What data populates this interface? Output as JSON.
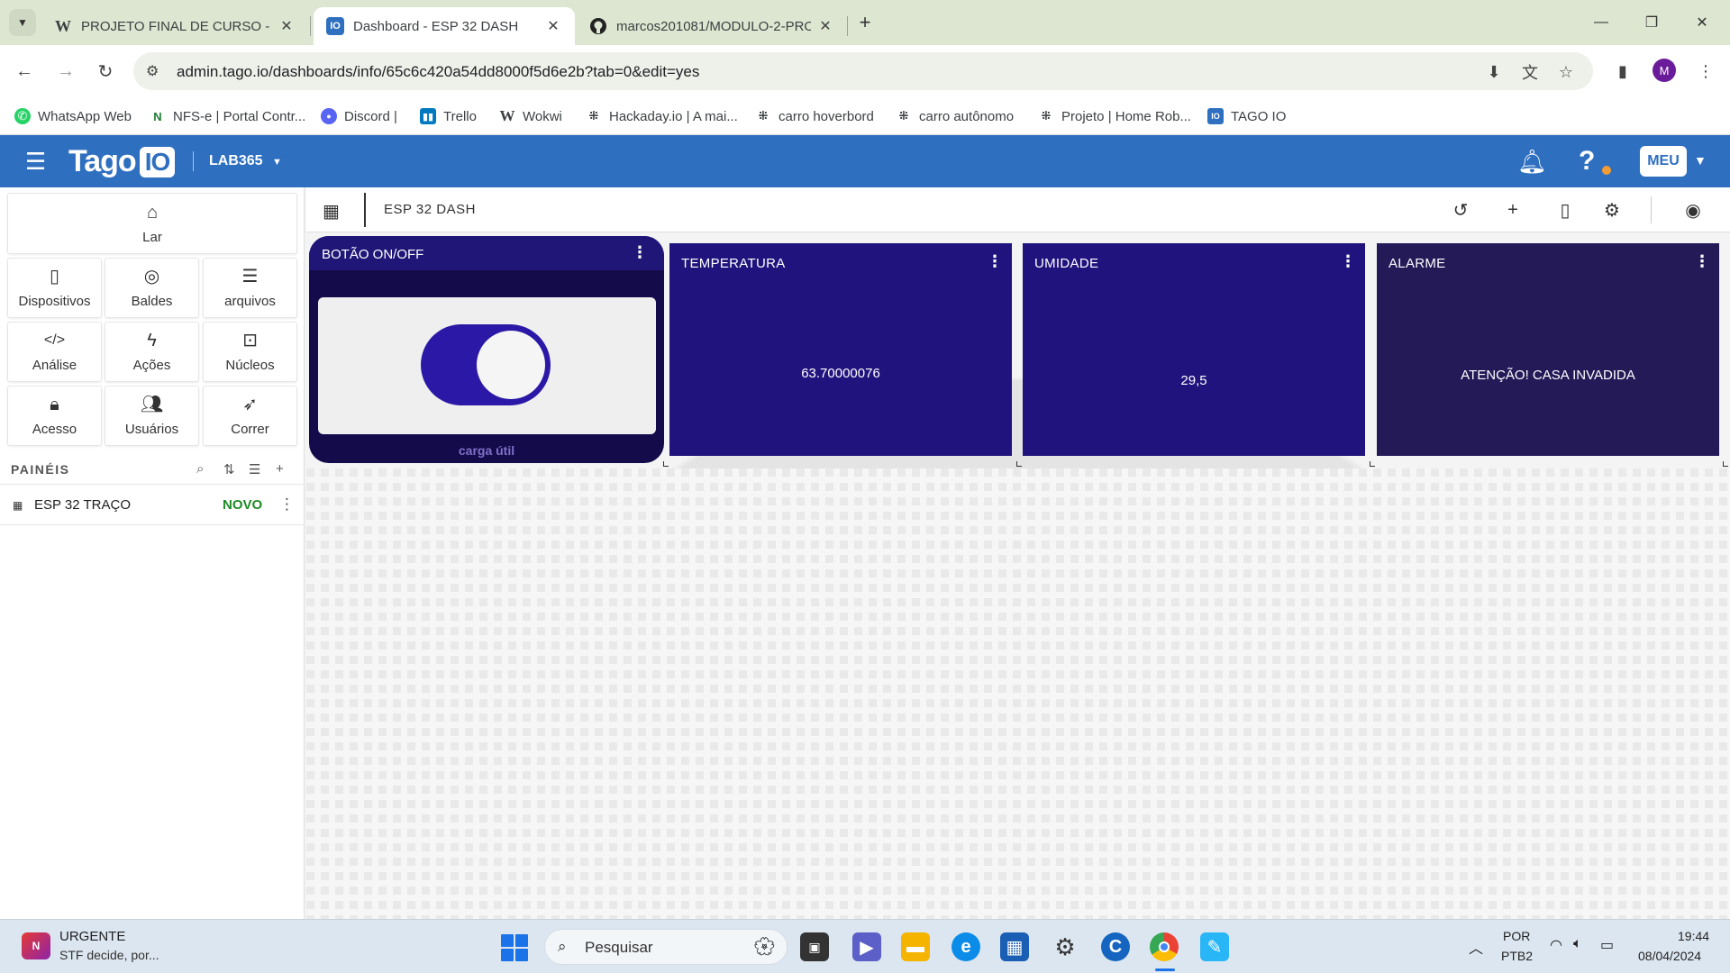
{
  "browser": {
    "tabs": [
      {
        "favicon": "W",
        "title": "PROJETO FINAL DE CURSO - W",
        "close": "✕"
      },
      {
        "favicon": "IO",
        "title": "Dashboard - ESP 32 DASH",
        "close": "✕"
      },
      {
        "favicon": "github-icon",
        "title": "marcos201081/MODULO-2-PRO",
        "close": "✕"
      }
    ],
    "new_tab": "+",
    "url": "admin.tago.io/dashboards/info/65c6c420a54dd8000f5d6e2b?tab=0&edit=yes",
    "profile_initial": "M",
    "bookmarks": [
      "WhatsApp Web",
      "NFS-e | Portal Contr...",
      "Discord |",
      "Trello",
      "Wokwi",
      "Hackaday.io | A mai...",
      "carro hoverbord",
      "carro autônomo",
      "Projeto | Home Rob...",
      "TAGO IO"
    ]
  },
  "tago": {
    "logo": "Tago",
    "logo_io": "IO",
    "profile": "LAB365",
    "user_button": "MEU",
    "sidebar": {
      "home": "Lar",
      "tiles": [
        "Dispositivos",
        "Baldes",
        "arquivos",
        "Análise",
        "Ações",
        "Núcleos",
        "Acesso",
        "Usuários",
        "Correr"
      ],
      "panels_label": "PAINÉIS",
      "panel_items": [
        {
          "name": "ESP 32 TRAÇO",
          "badge": "NOVO"
        }
      ]
    },
    "dashboard": {
      "title": "ESP 32 DASH",
      "widgets": {
        "switch": {
          "title": "BOTÃO ON/OFF",
          "caption": "carga útil",
          "state": "on"
        },
        "temperature": {
          "title": "TEMPERATURA",
          "value": "63.70000076"
        },
        "humidity": {
          "title": "UMIDADE",
          "value": "29,5"
        },
        "alarm": {
          "title": "ALARME",
          "value": "ATENÇÃO! CASA INVADIDA"
        }
      }
    }
  },
  "taskbar": {
    "news_title": "URGENTE",
    "news_sub": "STF decide, por...",
    "search_placeholder": "Pesquisar",
    "lang_line1": "POR",
    "lang_line2": "PTB2",
    "time": "19:44",
    "date": "08/04/2024"
  }
}
